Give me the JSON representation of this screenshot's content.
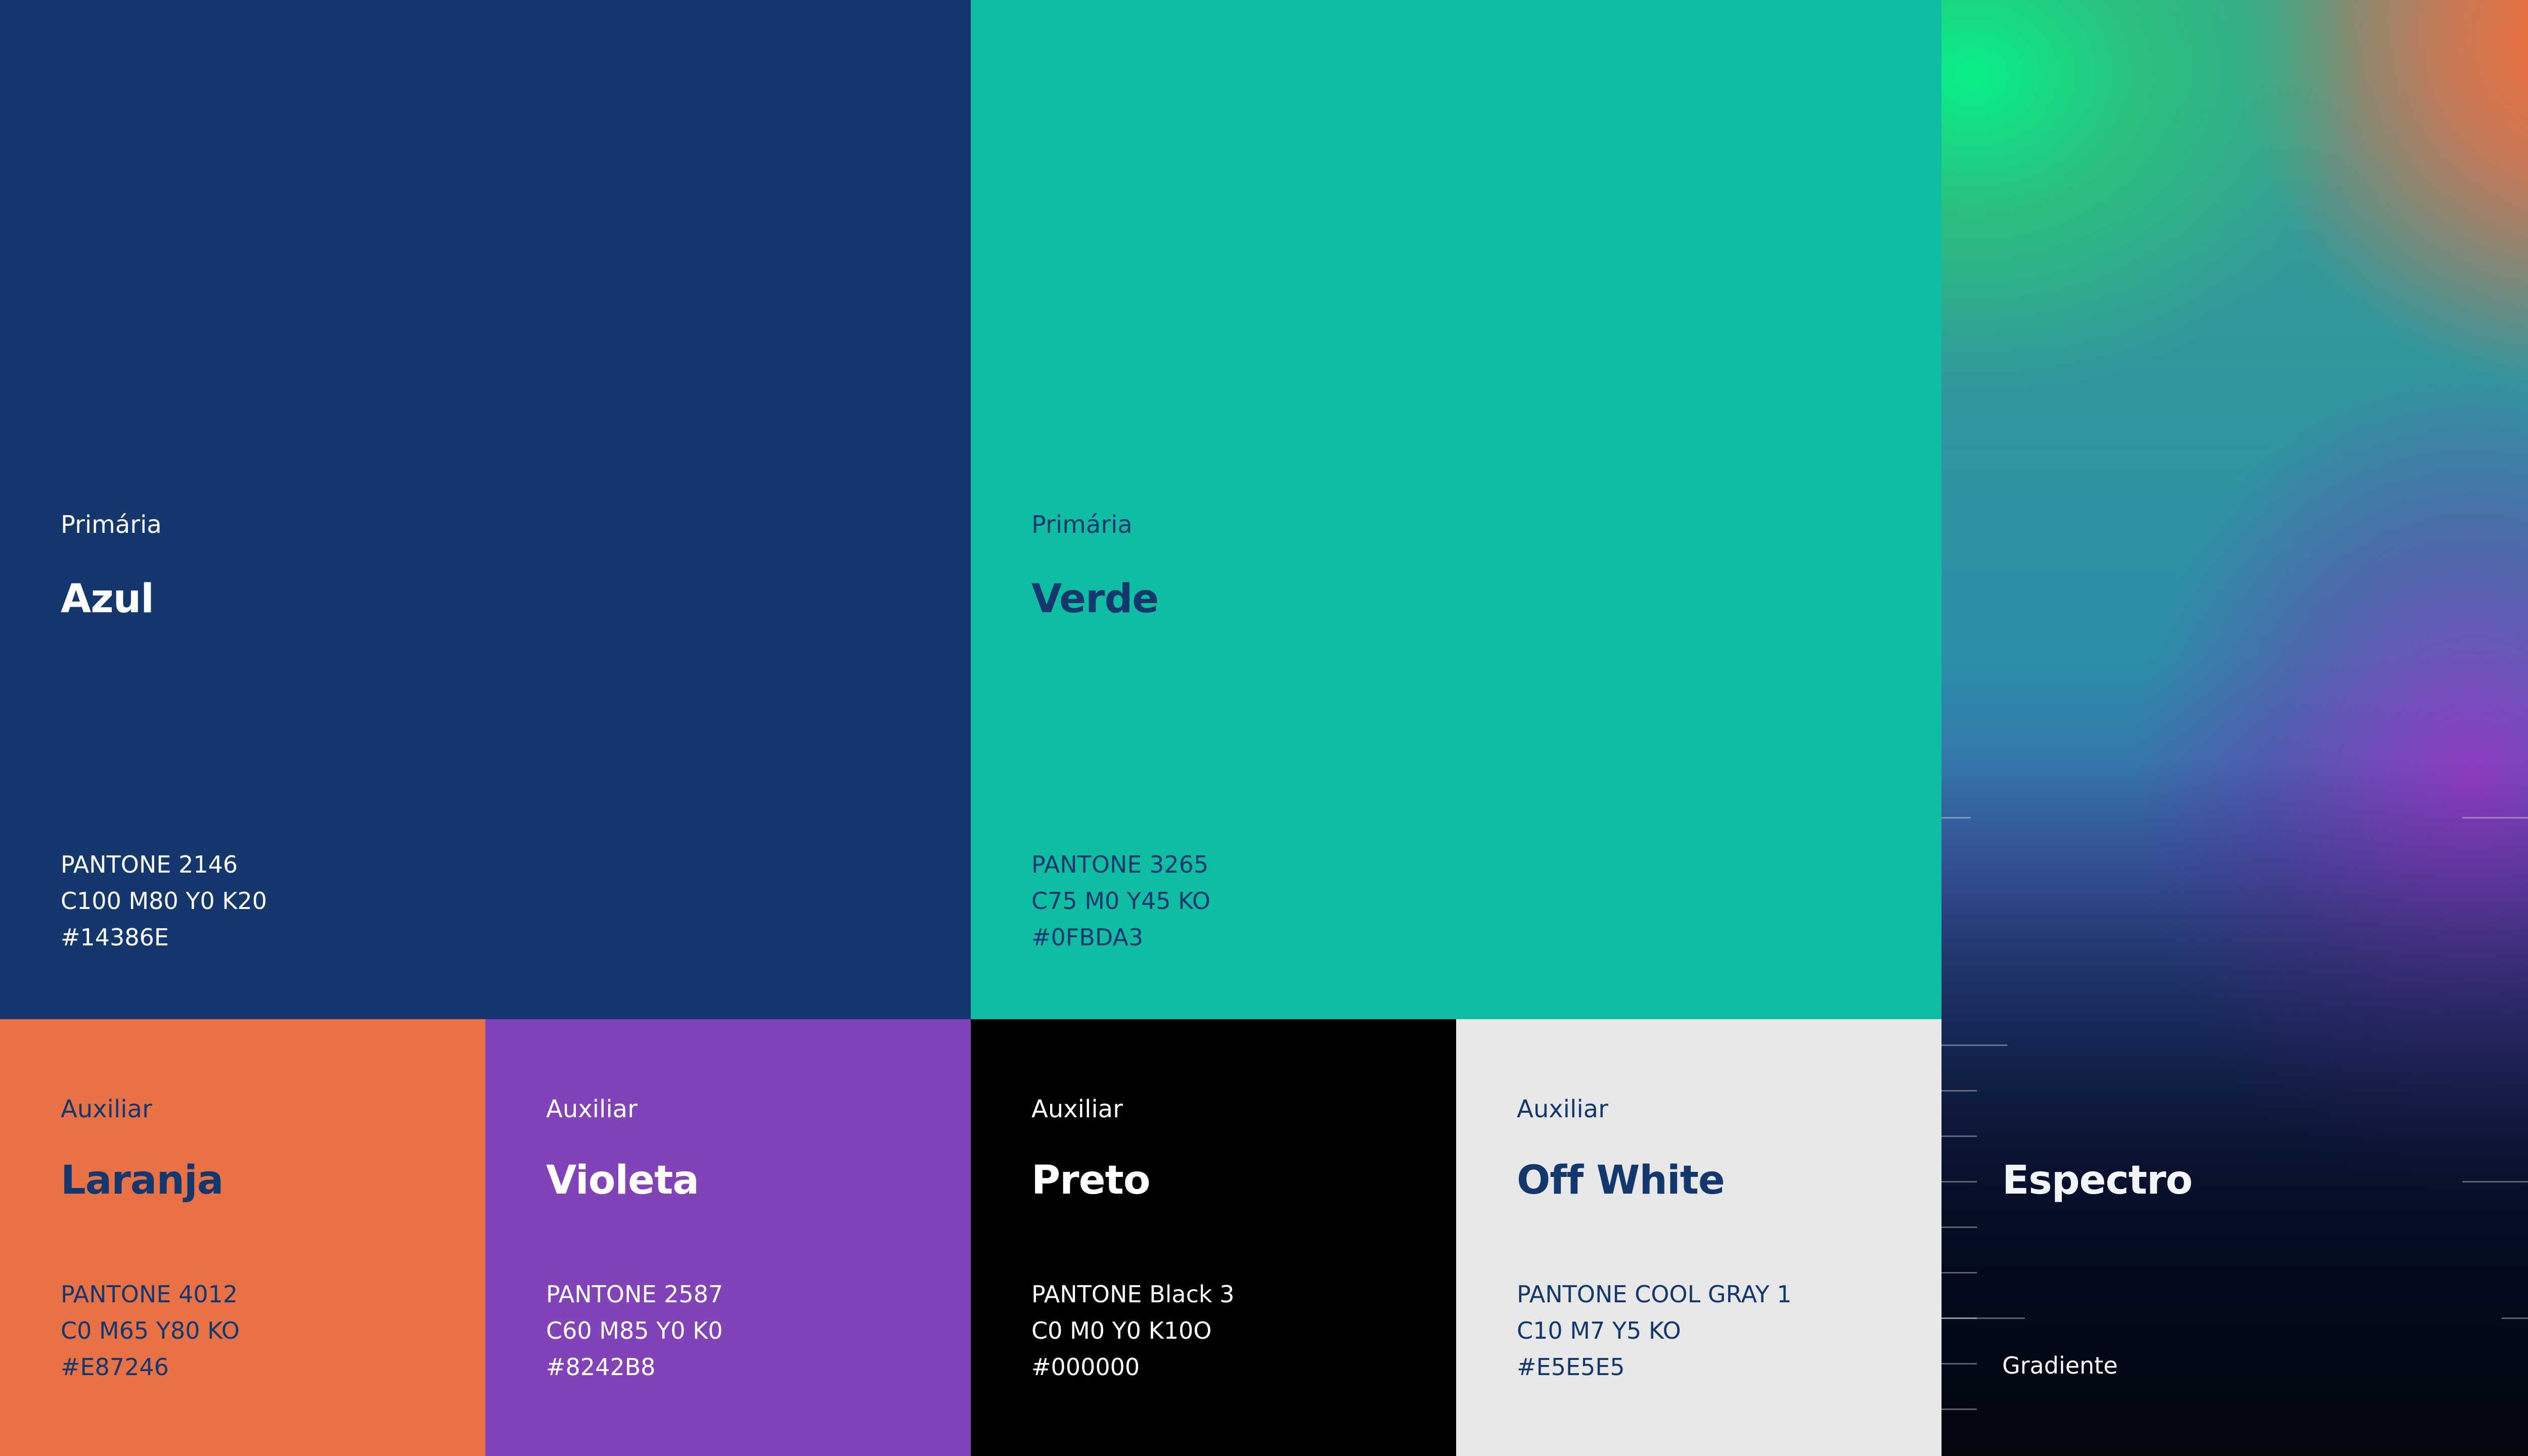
{
  "swatches": {
    "azul": {
      "tier": "Primária",
      "name": "Azul",
      "pantone": "PANTONE 2146",
      "cmyk": "C100  M80  Y0  K20",
      "hex": "#14386E",
      "bg_color": "#14386E",
      "text_color": "#FFFFFF"
    },
    "verde": {
      "tier": "Primária",
      "name": "Verde",
      "pantone": "PANTONE 3265",
      "cmyk": "C75  M0  Y45  KO",
      "hex": "#0FBDA3",
      "bg_color": "#0FBDA3",
      "text_color": "#14386E"
    },
    "laranja": {
      "tier": "Auxiliar",
      "name": "Laranja",
      "pantone": "PANTONE 4012",
      "cmyk": "C0  M65  Y80  KO",
      "hex": "#E87246",
      "bg_color": "#E87246",
      "text_color": "#14386E"
    },
    "violeta": {
      "tier": "Auxiliar",
      "name": "Violeta",
      "pantone": "PANTONE 2587",
      "cmyk": "C60  M85  Y0  K0",
      "hex": "#8242B8",
      "bg_color": "#8242B8",
      "text_color": "#FFFFFF"
    },
    "preto": {
      "tier": "Auxiliar",
      "name": "Preto",
      "pantone": "PANTONE Black 3",
      "cmyk": "C0  M0  Y0  K10O",
      "hex": "#000000",
      "bg_color": "#000000",
      "text_color": "#FFFFFF"
    },
    "offwhite": {
      "tier": "Auxiliar",
      "name": "Off White",
      "pantone": "PANTONE COOL GRAY 1",
      "cmyk": "C10  M7  Y5  KO",
      "hex": "#E5E5E5",
      "bg_color": "#E8E8E8",
      "text_color": "#14386E"
    },
    "espectro": {
      "name": "Espectro",
      "caption": "Gradiente",
      "gradient_colors": [
        "#08F08A",
        "#FF6A30",
        "#8242B8",
        "#14386E",
        "#000000"
      ]
    }
  }
}
